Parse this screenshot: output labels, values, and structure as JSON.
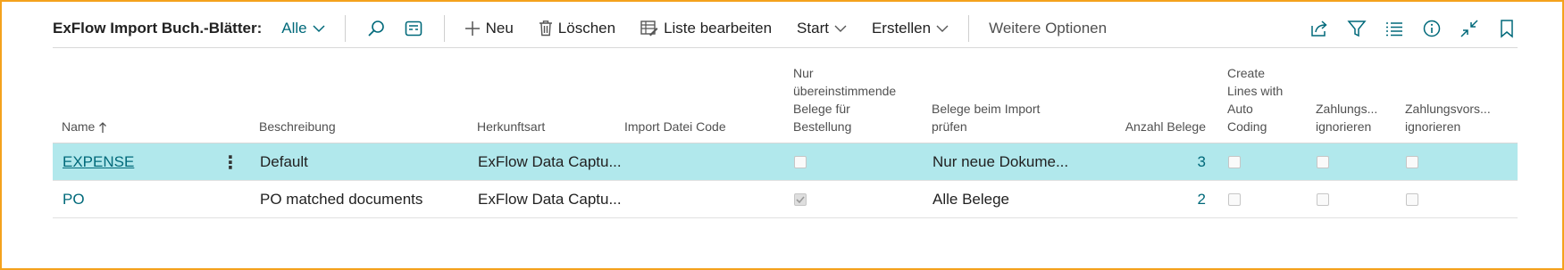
{
  "toolbar": {
    "title": "ExFlow Import Buch.-Blätter:",
    "filter_label": "Alle",
    "new_label": "Neu",
    "delete_label": "Löschen",
    "edit_list_label": "Liste bearbeiten",
    "start_label": "Start",
    "create_label": "Erstellen",
    "more_options_label": "Weitere Optionen",
    "icons": [
      "search-icon",
      "filter-pane-icon",
      "share-icon",
      "filter-icon",
      "list-view-icon",
      "info-icon",
      "collapse-icon",
      "bookmark-icon"
    ]
  },
  "table": {
    "headers": {
      "name": "Name",
      "description": "Beschreibung",
      "source_type": "Herkunftsart",
      "import_file_code": "Import Datei Code",
      "only_matching_line1": "Nur",
      "only_matching_line2": "übereinstimmende",
      "only_matching_line3": "Belege für",
      "only_matching_line4": "Bestellung",
      "check_docs_line1": "Belege beim Import",
      "check_docs_line2": "prüfen",
      "doc_count": "Anzahl Belege",
      "auto_coding_line1": "Create",
      "auto_coding_line2": "Lines with",
      "auto_coding_line3": "Auto",
      "auto_coding_line4": "Coding",
      "payment_ignore_line1": "Zahlungs...",
      "payment_ignore_line2": "ignorieren",
      "payment_proposal_line1": "Zahlungsvors...",
      "payment_proposal_line2": "ignorieren"
    },
    "rows": [
      {
        "name": "EXPENSE",
        "description": "Default",
        "source_type": "ExFlow Data Captu...",
        "import_file_code": "",
        "only_matching": false,
        "check_docs": "Nur neue Dokume...",
        "doc_count": "3",
        "auto_coding": false,
        "payment_ignore": false,
        "payment_proposal_ignore": false
      },
      {
        "name": "PO",
        "description": "PO matched documents",
        "source_type": "ExFlow Data Captu...",
        "import_file_code": "",
        "only_matching": true,
        "check_docs": "Alle Belege",
        "doc_count": "2",
        "auto_coding": false,
        "payment_ignore": false,
        "payment_proposal_ignore": false
      }
    ]
  },
  "colors": {
    "accent": "#00697a",
    "selected_row": "#b1e8ec",
    "frame": "#f4a21d"
  }
}
